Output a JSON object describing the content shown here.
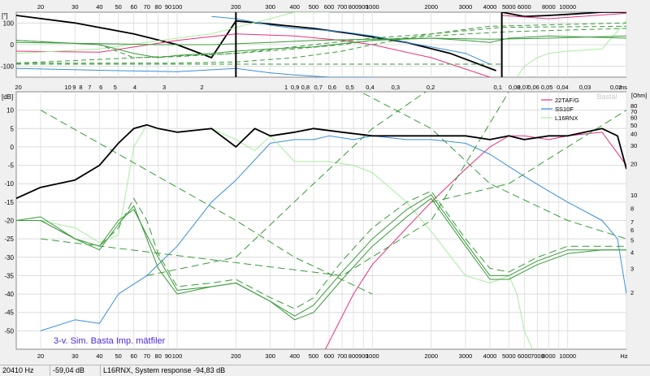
{
  "chart_data": [
    {
      "type": "line",
      "panel": "phase",
      "ylabel": "[°]",
      "y_ticks": [
        100,
        0,
        -100
      ],
      "ylim": [
        -150,
        150
      ],
      "x_scale": "log",
      "xlim": [
        15,
        20000
      ],
      "x_ticks_top": [
        "20",
        "30",
        "40",
        "50",
        "60",
        "70",
        "80",
        "90",
        "100",
        "200",
        "300",
        "400",
        "500",
        "600",
        "700",
        "800",
        "900",
        "1000",
        "2000",
        "3000",
        "4000",
        "5000",
        "6000",
        "8000",
        "10000"
      ],
      "grid": true,
      "series": [
        {
          "color": "#000000",
          "dashed": false,
          "x": [
            15,
            30,
            60,
            100,
            150,
            200,
            300,
            500,
            800,
            1500,
            2500,
            4300
          ],
          "y": [
            135,
            100,
            50,
            0,
            -60,
            110,
            95,
            75,
            50,
            10,
            -40,
            -120
          ]
        },
        {
          "color": "#000000",
          "dashed": false,
          "x": [
            4600,
            6000,
            8000,
            10000,
            15000,
            20000
          ],
          "y": [
            150,
            130,
            135,
            140,
            150,
            150
          ]
        },
        {
          "color": "#e8317a",
          "dashed": false,
          "x": [
            15,
            40,
            100,
            200,
            400,
            700,
            1000,
            2000,
            4000
          ],
          "y": [
            -30,
            -35,
            20,
            50,
            40,
            20,
            0,
            -60,
            -150
          ]
        },
        {
          "color": "#e8317a",
          "dashed": false,
          "x": [
            4600,
            8000,
            20000
          ],
          "y": [
            135,
            120,
            145
          ]
        },
        {
          "color": "#3a8fd9",
          "dashed": false,
          "x": [
            15,
            50,
            100,
            200,
            300,
            400,
            600,
            800,
            1000
          ],
          "y": [
            -110,
            -120,
            -125,
            -110,
            -130,
            -140,
            -150,
            -150,
            -150
          ]
        },
        {
          "color": "#3a8fd9",
          "dashed": false,
          "x": [
            150,
            200,
            300,
            400,
            500,
            700,
            1000,
            1500,
            2000,
            3000,
            4000
          ],
          "y": [
            130,
            120,
            90,
            75,
            70,
            60,
            40,
            10,
            -10,
            -40,
            -90
          ]
        },
        {
          "color": "#a7ee9d",
          "dashed": false,
          "x": [
            15,
            40,
            70,
            100,
            150,
            200,
            300,
            400,
            600
          ],
          "y": [
            -40,
            -20,
            10,
            30,
            50,
            80,
            120,
            150,
            150
          ]
        },
        {
          "color": "#a7ee9d",
          "dashed": false,
          "x": [
            5500,
            6000,
            7000,
            8000,
            10000,
            15000,
            20000
          ],
          "y": [
            -150,
            -100,
            -60,
            -40,
            -30,
            -20,
            110
          ]
        },
        {
          "color": "#3a9a3a",
          "dashed": false,
          "x": [
            15,
            40,
            60,
            80,
            100,
            150,
            200,
            300,
            500,
            800,
            1000,
            2000,
            3000,
            4000,
            5000,
            8000,
            20000
          ],
          "y": [
            20,
            0,
            -40,
            -60,
            -50,
            -40,
            -30,
            -20,
            -10,
            10,
            20,
            30,
            20,
            10,
            30,
            40,
            30
          ]
        },
        {
          "color": "#3a9a3a",
          "dashed": false,
          "x": [
            15,
            40,
            80,
            150,
            300,
            500,
            1000,
            2000,
            4000,
            8000,
            20000
          ],
          "y": [
            10,
            5,
            0,
            0,
            10,
            20,
            25,
            30,
            25,
            30,
            40
          ]
        },
        {
          "color": "#3a9a3a",
          "dashed": true,
          "x": [
            15,
            40,
            60,
            100,
            200,
            400,
            700,
            1000,
            2000,
            5000,
            20000
          ],
          "y": [
            20,
            0,
            -60,
            -55,
            -40,
            -20,
            0,
            20,
            40,
            60,
            75
          ]
        },
        {
          "color": "#3a9a3a",
          "dashed": true,
          "x": [
            15,
            100,
            200,
            400,
            700,
            1000,
            2000,
            4000,
            20000
          ],
          "y": [
            -85,
            -85,
            -80,
            -60,
            -30,
            0,
            50,
            85,
            100
          ]
        },
        {
          "color": "#3a9a3a",
          "dashed": true,
          "x": [
            15,
            100,
            1000,
            4600
          ],
          "y": [
            -90,
            -90,
            -90,
            -90
          ]
        },
        {
          "color": "#3a9a3a",
          "dashed": true,
          "x": [
            15,
            200,
            500,
            1000,
            2000,
            4600,
            20000
          ],
          "y": [
            -85,
            -40,
            0,
            30,
            50,
            80,
            85
          ]
        }
      ],
      "selection_x": [
        200,
        4600
      ]
    },
    {
      "type": "line",
      "panel": "magnitude",
      "ylabel": "[dB]",
      "ylabel_right": "[Ohm]",
      "y_ticks": [
        10,
        5,
        0,
        -5,
        -10,
        -15,
        -20,
        -25,
        -30,
        -35,
        -40,
        -45,
        -50
      ],
      "ylim": [
        -55,
        15
      ],
      "x_scale": "log",
      "xlim": [
        15,
        20000
      ],
      "x_ticks": [
        "20",
        "30",
        "40",
        "50",
        "60",
        "70",
        "80",
        "90",
        "100",
        "200",
        "300",
        "400",
        "500",
        "600",
        "700",
        "800",
        "900",
        "1000",
        "2000",
        "3000",
        "4000",
        "5000",
        "6000",
        "7000",
        "8000",
        "10000"
      ],
      "x_unit": "Hz",
      "top_ticks": [
        [
          "20",
          15.5
        ],
        [
          "10",
          33.5
        ],
        [
          "9",
          37
        ],
        [
          "8",
          41
        ],
        [
          "7",
          47
        ],
        [
          "6",
          56
        ],
        [
          "5",
          70
        ],
        [
          "4",
          95
        ],
        [
          "3",
          150
        ],
        [
          "2",
          270
        ],
        [
          "1",
          1000
        ],
        [
          "0,9",
          1150
        ],
        [
          "0,8",
          1350
        ],
        [
          "0,7",
          1650
        ],
        [
          "0,6",
          2050
        ],
        [
          "0,5",
          2700
        ],
        [
          "0,4",
          3700
        ],
        [
          "0,3",
          5500
        ],
        [
          "0,2",
          9500
        ],
        [
          "0,1",
          27000
        ],
        [
          "0,08",
          35000
        ],
        [
          "0,07",
          40000
        ],
        [
          "0,06",
          47000
        ],
        [
          "0,05",
          58000
        ],
        [
          "0,04",
          74000
        ],
        [
          "0,03",
          105000
        ],
        [
          "0,02",
          170000
        ],
        [
          "ms",
          190000
        ]
      ],
      "right_ticks": [
        [
          "80",
          11.3
        ],
        [
          "70",
          9.7
        ],
        [
          "60",
          8.0
        ],
        [
          "50",
          6.0
        ],
        [
          "40",
          3.6
        ],
        [
          "30",
          0.4
        ],
        [
          "20",
          -4.5
        ],
        [
          "10",
          -13.0
        ],
        [
          "8",
          -16.7
        ],
        [
          "7",
          -20.3
        ],
        [
          "6",
          -22.5
        ],
        [
          "5",
          -25.3
        ],
        [
          "4",
          -28.6
        ],
        [
          "3",
          -33.0
        ],
        [
          "2",
          -39.5
        ]
      ],
      "legend": [
        "22TAF/G",
        "SS10F",
        "L16RNX"
      ],
      "legend_colors": [
        "#e8317a",
        "#3a8fd9",
        "#a7ee9d"
      ],
      "legend_position": "top-right",
      "watermark": "Basta!",
      "annotation": "3-v. Sim. Basta Imp. mätfiler",
      "grid": true,
      "series": [
        {
          "name": "22TAF/G",
          "color": "#e8317a",
          "dashed": false,
          "x": [
            550,
            800,
            1000,
            1500,
            2000,
            3000,
            4000,
            5000,
            6000,
            8000,
            10000,
            15000,
            20000
          ],
          "y": [
            -57,
            -40,
            -32,
            -22,
            -15,
            -6,
            0,
            3,
            3,
            2,
            3,
            4,
            -5
          ]
        },
        {
          "name": "SS10F",
          "color": "#3a8fd9",
          "dashed": false,
          "x": [
            20,
            30,
            40,
            50,
            70,
            100,
            150,
            200,
            300,
            400,
            500,
            600,
            800,
            1000,
            1500,
            2000,
            3000,
            4000,
            6000,
            8000,
            10000,
            15000,
            18000,
            20000
          ],
          "y": [
            -50,
            -47,
            -48,
            -40,
            -35,
            -27,
            -15,
            -9,
            1,
            2,
            2,
            3,
            2,
            3,
            2,
            2,
            1,
            -2,
            -8,
            -12,
            -15,
            -20,
            -25,
            -40
          ]
        },
        {
          "name": "L16RNX",
          "color": "#a7ee9d",
          "dashed": false,
          "x": [
            20,
            30,
            40,
            50,
            60,
            70,
            80,
            100,
            150,
            200,
            250,
            300,
            400,
            600,
            800,
            1000,
            1500,
            2000,
            3000,
            4000,
            5000,
            5500,
            6000,
            7000
          ],
          "y": [
            -20,
            -22,
            -26,
            -24,
            0,
            6,
            5,
            4,
            5,
            2,
            -1,
            3,
            -4,
            -4,
            -5,
            -7,
            -15,
            -23,
            -35,
            -37,
            -35,
            -40,
            -50,
            -58
          ]
        },
        {
          "color": "#000000",
          "dashed": false,
          "x": [
            15,
            20,
            30,
            40,
            50,
            60,
            70,
            80,
            100,
            150,
            200,
            250,
            300,
            400,
            500,
            700,
            1000,
            1500,
            2000,
            3000,
            4000,
            5000,
            6000,
            8000,
            10000,
            15000,
            18000,
            20000
          ],
          "y": [
            -14,
            -11,
            -9,
            -5,
            1,
            5,
            6,
            5,
            4,
            5,
            0,
            5,
            3,
            4,
            5,
            4,
            3,
            3,
            3,
            3,
            2,
            3,
            2,
            3,
            3,
            5,
            3,
            -6
          ]
        },
        {
          "color": "#3a9a3a",
          "dashed": false,
          "x": [
            15,
            20,
            30,
            40,
            50,
            60,
            70,
            80,
            100,
            150,
            200,
            300,
            400,
            500,
            700,
            1000,
            1500,
            2000,
            3000,
            4000,
            5000,
            7000,
            10000,
            15000,
            20000
          ],
          "y": [
            -20,
            -19,
            -25,
            -27,
            -20,
            -17,
            -24,
            -30,
            -39,
            -38,
            -37,
            -42,
            -46,
            -43,
            -34,
            -25,
            -17,
            -13,
            -26,
            -35,
            -35,
            -31,
            -28,
            -28,
            -28
          ]
        },
        {
          "color": "#3a9a3a",
          "dashed": false,
          "x": [
            15,
            20,
            30,
            40,
            50,
            60,
            70,
            80,
            100,
            150,
            200,
            300,
            400,
            500,
            700,
            1000,
            1500,
            2000,
            3000,
            4000,
            5000,
            7000,
            10000,
            15000,
            20000
          ],
          "y": [
            -20,
            -20,
            -25,
            -28,
            -21,
            -16,
            -25,
            -33,
            -40,
            -38,
            -37,
            -42,
            -47,
            -45,
            -36,
            -27,
            -19,
            -14,
            -27,
            -36,
            -36,
            -32,
            -29,
            -28,
            -28
          ]
        },
        {
          "color": "#3a9a3a",
          "dashed": true,
          "x": [
            15,
            20,
            30,
            40,
            50,
            60,
            70,
            80,
            100,
            150,
            200,
            300,
            400,
            500,
            700,
            1000,
            1500,
            2000,
            3000,
            4000,
            5000,
            7000,
            10000,
            15000,
            20000
          ],
          "y": [
            -20,
            -20,
            -25,
            -27,
            -22,
            -14,
            -20,
            -29,
            -38,
            -37,
            -36,
            -41,
            -44,
            -41,
            -31,
            -22,
            -15,
            -12,
            -25,
            -33,
            -34,
            -30,
            -27,
            -27,
            -27
          ]
        },
        {
          "color": "#3a9a3a",
          "dashed": true,
          "x": [
            20,
            200,
            400,
            1000
          ],
          "y": [
            10,
            -20,
            -30,
            -40
          ]
        },
        {
          "color": "#3a9a3a",
          "dashed": true,
          "x": [
            20,
            700,
            2000,
            5000,
            20000
          ],
          "y": [
            -25,
            -35,
            -20,
            15,
            30
          ]
        },
        {
          "color": "#3a9a3a",
          "dashed": true,
          "x": [
            70,
            200,
            500,
            1000,
            2000
          ],
          "y": [
            -35,
            -30,
            -10,
            5,
            16
          ]
        },
        {
          "color": "#3a9a3a",
          "dashed": true,
          "x": [
            800,
            2000,
            4000,
            10000,
            20000
          ],
          "y": [
            16,
            5,
            -10,
            -20,
            -25
          ]
        },
        {
          "color": "#3a9a3a",
          "dashed": true,
          "x": [
            2000,
            5000,
            10000,
            20000
          ],
          "y": [
            -15,
            -10,
            0,
            10
          ]
        }
      ]
    }
  ],
  "status_bar": {
    "frequency": "20410 Hz",
    "level": "-59,04 dB",
    "message": "L16RNX, System response -94,83 dB"
  }
}
